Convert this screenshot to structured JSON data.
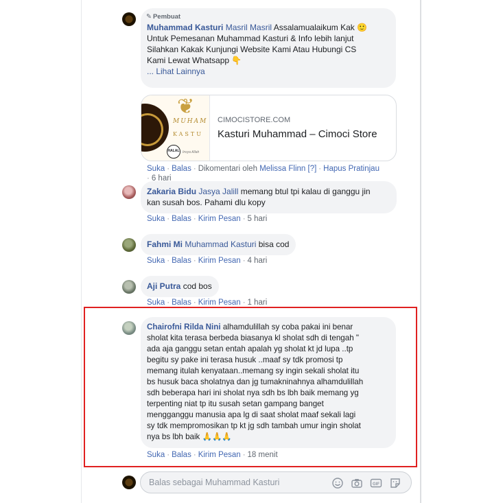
{
  "reply_composer": {
    "placeholder": "Balas sebagai Muhammad Kasturi"
  },
  "comments": [
    {
      "badge": "Pembuat",
      "author": "Muhammad Kasturi",
      "mention": "Masril Masril",
      "text_lines": [
        "Assalamualaikum Kak 🙂",
        "Untuk Pemesanan Muhammad Kasturi & Info lebih lanjut",
        "Silahkan Kakak Kunjungi Website Kami Atau Hubungi CS",
        "Kami Lewat Whatsapp 👇"
      ],
      "see_more": "... Lihat Lainnya",
      "link_preview": {
        "domain": "CIMOCISTORE.COM",
        "title": "Kasturi Muhammad – Cimoci Store",
        "image_text_1": "MUHAM",
        "image_text_2": "KASTU",
        "halal_label": "HALAL",
        "image_small_text": "Insya Allah"
      },
      "actions": {
        "like": "Suka",
        "reply": "Balas",
        "commented_by": "Dikomentari oleh",
        "commented_by_name": "Melissa Flinn",
        "help_mark": "[?]",
        "remove_preview": "Hapus Pratinjau",
        "time": "6 hari"
      }
    },
    {
      "author": "Zakaria Bidu",
      "mention": "Jasya Jalill",
      "text_lines": [
        "memang btul tpi kalau di ganggu jin",
        "kan susah bos. Pahami dlu kopy"
      ],
      "actions": {
        "like": "Suka",
        "reply": "Balas",
        "message": "Kirim Pesan",
        "time": "5 hari"
      }
    },
    {
      "author": "Fahmi Mi",
      "mention": "Muhammad Kasturi",
      "text_lines": [
        "bisa cod"
      ],
      "actions": {
        "like": "Suka",
        "reply": "Balas",
        "message": "Kirim Pesan",
        "time": "4 hari"
      }
    },
    {
      "author": "Aji Putra",
      "text_lines": [
        "cod bos"
      ],
      "actions": {
        "like": "Suka",
        "reply": "Balas",
        "message": "Kirim Pesan",
        "time": "1 hari"
      }
    },
    {
      "author": "Chairofni Rilda Nini",
      "text_lines": [
        "alhamdulillah sy coba pakai ini benar",
        "sholat kita terasa berbeda biasanya kl sholat sdh di tengah \"",
        "ada aja ganggu setan entah apalah yg sholat kt jd lupa ..tp",
        "begitu sy pake ini terasa husuk ..maaf sy tdk promosi tp",
        "memang itulah kenyataan..memang sy ingin sekali sholat itu",
        "bs husuk baca sholatnya dan jg tumakninahnya alhamdulillah",
        "sdh beberapa hari ini sholat nya sdh bs lbh baik memang yg",
        "terpenting niat tp itu susah setan gampang banget",
        "mengganggu manusia apa lg di saat sholat maaf sekali lagi",
        "sy tdk mempromosikan tp kt jg sdh tambah umur ingin sholat",
        "nya bs lbh baik 🙏🙏🙏"
      ],
      "actions": {
        "like": "Suka",
        "reply": "Balas",
        "message": "Kirim Pesan",
        "time": "18 menit"
      }
    }
  ]
}
